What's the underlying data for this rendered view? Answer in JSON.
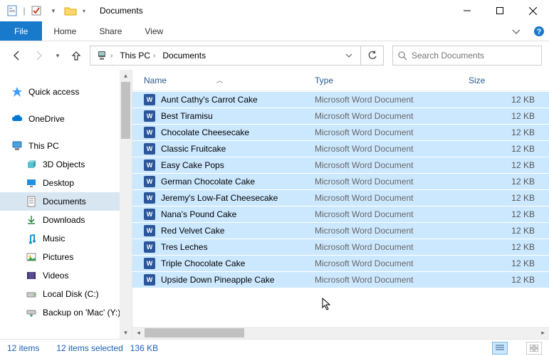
{
  "window": {
    "title": "Documents"
  },
  "ribbon": {
    "file": "File",
    "tabs": [
      "Home",
      "Share",
      "View"
    ]
  },
  "breadcrumb": [
    "This PC",
    "Documents"
  ],
  "search": {
    "placeholder": "Search Documents"
  },
  "sidebar": {
    "quick_access": "Quick access",
    "onedrive": "OneDrive",
    "this_pc": "This PC",
    "children": [
      {
        "label": "3D Objects",
        "icon": "3d"
      },
      {
        "label": "Desktop",
        "icon": "desktop"
      },
      {
        "label": "Documents",
        "icon": "documents",
        "selected": true
      },
      {
        "label": "Downloads",
        "icon": "downloads"
      },
      {
        "label": "Music",
        "icon": "music"
      },
      {
        "label": "Pictures",
        "icon": "pictures"
      },
      {
        "label": "Videos",
        "icon": "videos"
      },
      {
        "label": "Local Disk (C:)",
        "icon": "disk"
      },
      {
        "label": "Backup on 'Mac' (Y:)",
        "icon": "netdisk"
      }
    ]
  },
  "columns": {
    "name": "Name",
    "type": "Type",
    "size": "Size"
  },
  "files": [
    {
      "name": "Aunt Cathy's Carrot Cake",
      "type": "Microsoft Word Document",
      "size": "12 KB"
    },
    {
      "name": "Best Tiramisu",
      "type": "Microsoft Word Document",
      "size": "12 KB"
    },
    {
      "name": "Chocolate Cheesecake",
      "type": "Microsoft Word Document",
      "size": "12 KB"
    },
    {
      "name": "Classic Fruitcake",
      "type": "Microsoft Word Document",
      "size": "12 KB"
    },
    {
      "name": "Easy Cake Pops",
      "type": "Microsoft Word Document",
      "size": "12 KB"
    },
    {
      "name": "German Chocolate Cake",
      "type": "Microsoft Word Document",
      "size": "12 KB"
    },
    {
      "name": "Jeremy's Low-Fat Cheesecake",
      "type": "Microsoft Word Document",
      "size": "12 KB"
    },
    {
      "name": "Nana's Pound Cake",
      "type": "Microsoft Word Document",
      "size": "12 KB"
    },
    {
      "name": "Red Velvet Cake",
      "type": "Microsoft Word Document",
      "size": "12 KB"
    },
    {
      "name": "Tres Leches",
      "type": "Microsoft Word Document",
      "size": "12 KB"
    },
    {
      "name": "Triple Chocolate Cake",
      "type": "Microsoft Word Document",
      "size": "12 KB"
    },
    {
      "name": "Upside Down Pineapple Cake",
      "type": "Microsoft Word Document",
      "size": "12 KB"
    }
  ],
  "status": {
    "count": "12 items",
    "selected": "12 items selected",
    "size": "136 KB"
  }
}
